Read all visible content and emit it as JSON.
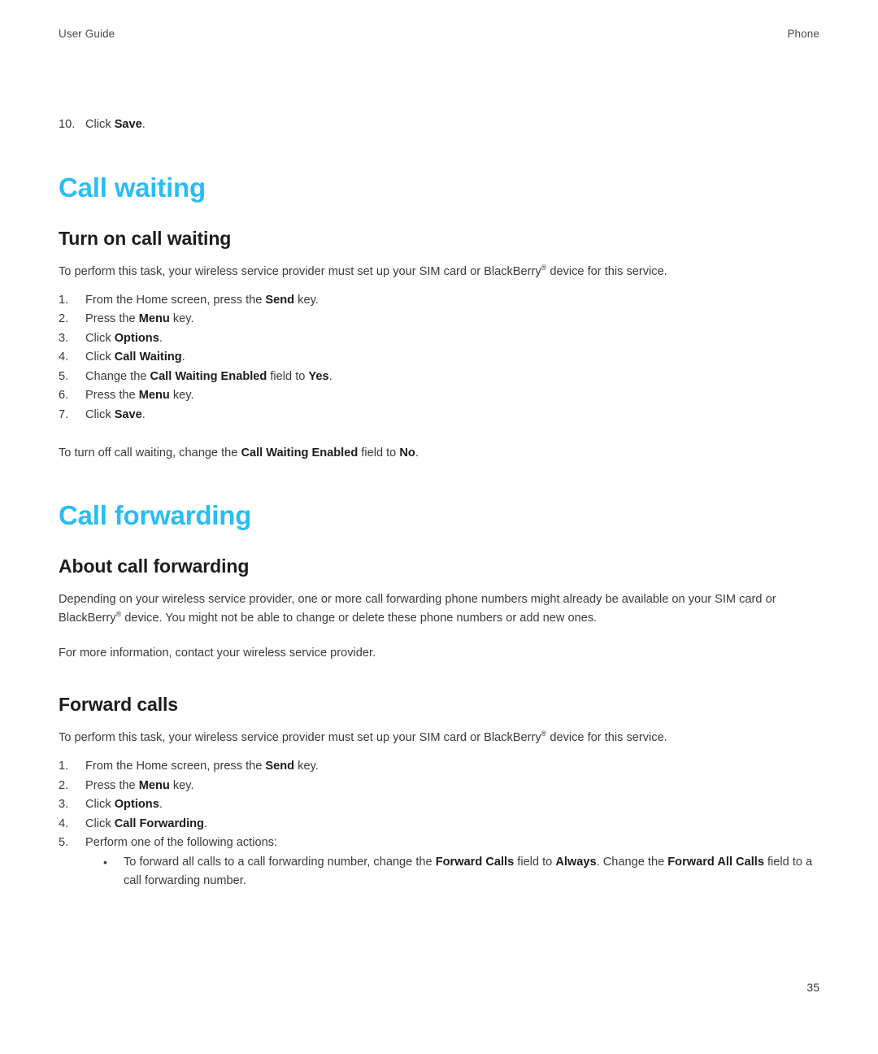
{
  "running_head": {
    "left": "User Guide",
    "right": "Phone"
  },
  "accent_color": "#29bdf4",
  "body_color": "#3a3a3a",
  "folio": "35",
  "carryover_step": {
    "number": "10.",
    "text_before": "Click ",
    "bold": "Save",
    "text_after": "."
  },
  "sections": [
    {
      "id": "call-waiting",
      "title": "Call waiting",
      "subsections": [
        {
          "id": "turn-on-call-waiting",
          "title": "Turn on call waiting",
          "intro": "To perform this task, your wireless service provider must set up your SIM card or BlackBerry® device for this service.",
          "steps": [
            {
              "number": "1.",
              "parts": [
                {
                  "t": "From the Home screen, press the ",
                  "b": false
                },
                {
                  "t": "Send",
                  "b": true
                },
                {
                  "t": " key.",
                  "b": false
                }
              ]
            },
            {
              "number": "2.",
              "parts": [
                {
                  "t": "Press the ",
                  "b": false
                },
                {
                  "t": "Menu",
                  "b": true
                },
                {
                  "t": " key.",
                  "b": false
                }
              ]
            },
            {
              "number": "3.",
              "parts": [
                {
                  "t": "Click ",
                  "b": false
                },
                {
                  "t": "Options",
                  "b": true
                },
                {
                  "t": ".",
                  "b": false
                }
              ]
            },
            {
              "number": "4.",
              "parts": [
                {
                  "t": "Click ",
                  "b": false
                },
                {
                  "t": "Call Waiting",
                  "b": true
                },
                {
                  "t": ".",
                  "b": false
                }
              ]
            },
            {
              "number": "5.",
              "parts": [
                {
                  "t": "Change the ",
                  "b": false
                },
                {
                  "t": "Call Waiting Enabled",
                  "b": true
                },
                {
                  "t": " field to ",
                  "b": false
                },
                {
                  "t": "Yes",
                  "b": true
                },
                {
                  "t": ".",
                  "b": false
                }
              ]
            },
            {
              "number": "6.",
              "parts": [
                {
                  "t": "Press the ",
                  "b": false
                },
                {
                  "t": "Menu",
                  "b": true
                },
                {
                  "t": " key.",
                  "b": false
                }
              ]
            },
            {
              "number": "7.",
              "parts": [
                {
                  "t": "Click ",
                  "b": false
                },
                {
                  "t": "Save",
                  "b": true
                },
                {
                  "t": ".",
                  "b": false
                }
              ]
            }
          ],
          "closing": [
            {
              "t": "To turn off call waiting, change the ",
              "b": false
            },
            {
              "t": "Call Waiting Enabled",
              "b": true
            },
            {
              "t": " field to ",
              "b": false
            },
            {
              "t": "No",
              "b": true
            },
            {
              "t": ".",
              "b": false
            }
          ]
        }
      ]
    },
    {
      "id": "call-forwarding",
      "title": "Call forwarding",
      "subsections": [
        {
          "id": "about-call-forwarding",
          "title": "About call forwarding",
          "paragraphs": [
            "Depending on your wireless service provider, one or more call forwarding phone numbers might already be available on your SIM card or BlackBerry® device. You might not be able to change or delete these phone numbers or add new ones.",
            "For more information, contact your wireless service provider."
          ]
        },
        {
          "id": "forward-calls",
          "title": "Forward calls",
          "intro": "To perform this task, your wireless service provider must set up your SIM card or BlackBerry® device for this service.",
          "steps": [
            {
              "number": "1.",
              "parts": [
                {
                  "t": "From the Home screen, press the ",
                  "b": false
                },
                {
                  "t": "Send",
                  "b": true
                },
                {
                  "t": " key.",
                  "b": false
                }
              ]
            },
            {
              "number": "2.",
              "parts": [
                {
                  "t": "Press the ",
                  "b": false
                },
                {
                  "t": "Menu",
                  "b": true
                },
                {
                  "t": " key.",
                  "b": false
                }
              ]
            },
            {
              "number": "3.",
              "parts": [
                {
                  "t": "Click ",
                  "b": false
                },
                {
                  "t": "Options",
                  "b": true
                },
                {
                  "t": ".",
                  "b": false
                }
              ]
            },
            {
              "number": "4.",
              "parts": [
                {
                  "t": "Click ",
                  "b": false
                },
                {
                  "t": "Call Forwarding",
                  "b": true
                },
                {
                  "t": ".",
                  "b": false
                }
              ]
            },
            {
              "number": "5.",
              "parts": [
                {
                  "t": "Perform one of the following actions:",
                  "b": false
                }
              ],
              "bullets": [
                {
                  "marker": "•",
                  "parts": [
                    {
                      "t": "To forward all calls to a call forwarding number, change the ",
                      "b": false
                    },
                    {
                      "t": "Forward Calls",
                      "b": true
                    },
                    {
                      "t": " field to ",
                      "b": false
                    },
                    {
                      "t": "Always",
                      "b": true
                    },
                    {
                      "t": ". Change the ",
                      "b": false
                    },
                    {
                      "t": "Forward All Calls",
                      "b": true
                    },
                    {
                      "t": " field to a call forwarding number.",
                      "b": false
                    }
                  ]
                }
              ]
            }
          ]
        }
      ]
    }
  ]
}
